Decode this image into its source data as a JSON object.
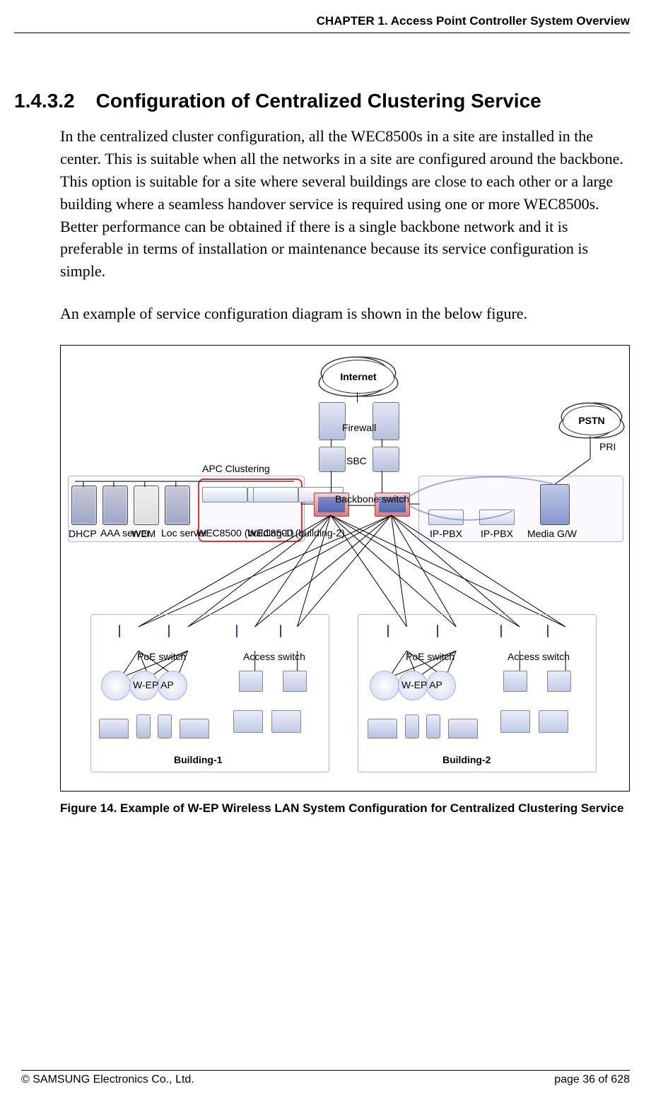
{
  "header": {
    "chapter": "CHAPTER 1. Access Point Controller System Overview"
  },
  "section": {
    "number": "1.4.3.2",
    "title": "Configuration of Centralized Clustering Service"
  },
  "paragraphs": {
    "p1": "In the centralized cluster configuration, all the WEC8500s in a site are installed in the center. This is suitable when all the networks in a site are configured around the backbone. This option is suitable for a site where several buildings are close to each other or a large building where a seamless handover service is required using one or more WEC8500s. Better performance can be obtained if there is a single backbone network and it is preferable in terms of installation or maintenance because its service configuration is simple.",
    "p2": "An example of service configuration diagram is shown in the below figure."
  },
  "diagram": {
    "internet": "Internet",
    "pstn": "PSTN",
    "pri": "PRI",
    "firewall": "Firewall",
    "sbc": "SBC",
    "apc_clustering": "APC Clustering",
    "backbone_switch": "Backbone switch",
    "servers": {
      "dhcp": "DHCP",
      "aaa": "AAA server",
      "wem": "WEM",
      "loc": "Loc server",
      "wec1": "WEC8500 (building-1)",
      "wec2": "WEC8500 (building-2)"
    },
    "right": {
      "ippbx1": "IP-PBX",
      "ippbx2": "IP-PBX",
      "media_gw": "Media G/W"
    },
    "buildings": {
      "b1": {
        "poe_switch": "PoE switch",
        "access_switch": "Access switch",
        "wep_ap": "W-EP AP",
        "name": "Building-1"
      },
      "b2": {
        "poe_switch": "PoE switch",
        "access_switch": "Access switch",
        "wep_ap": "W-EP AP",
        "name": "Building-2"
      }
    }
  },
  "figure_caption": "Figure 14. Example of W-EP Wireless LAN System Configuration for Centralized Clustering Service",
  "footer": {
    "copyright": "© SAMSUNG Electronics Co., Ltd.",
    "page": "page 36 of 628"
  }
}
